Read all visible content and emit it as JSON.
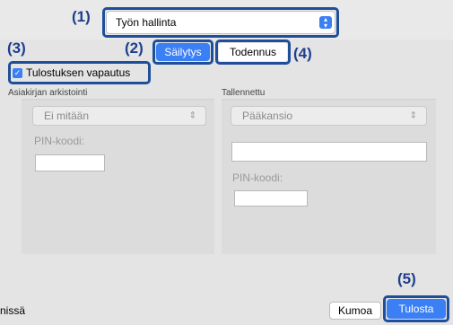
{
  "callouts": {
    "c1": "(1)",
    "c2": "(2)",
    "c3": "(3)",
    "c4": "(4)",
    "c5": "(5)"
  },
  "top_select": {
    "value": "Työn hallinta"
  },
  "tabs": {
    "storage": "Säilytys",
    "auth": "Todennus"
  },
  "release_checkbox": {
    "label": "Tulostuksen vapautus",
    "checked": true
  },
  "archive": {
    "section_label": "Asiakirjan arkistointi",
    "select_value": "Ei mitään",
    "pin_label": "PIN-koodi:"
  },
  "saved": {
    "section_label": "Tallennettu",
    "select_value": "Pääkansio",
    "pin_label": "PIN-koodi:"
  },
  "footer": {
    "left_text": "nissä",
    "cancel_label": "Kumoa",
    "print_label": "Tulosta"
  },
  "colors": {
    "accent": "#3b7ff5",
    "callout": "#1f4e9a"
  }
}
